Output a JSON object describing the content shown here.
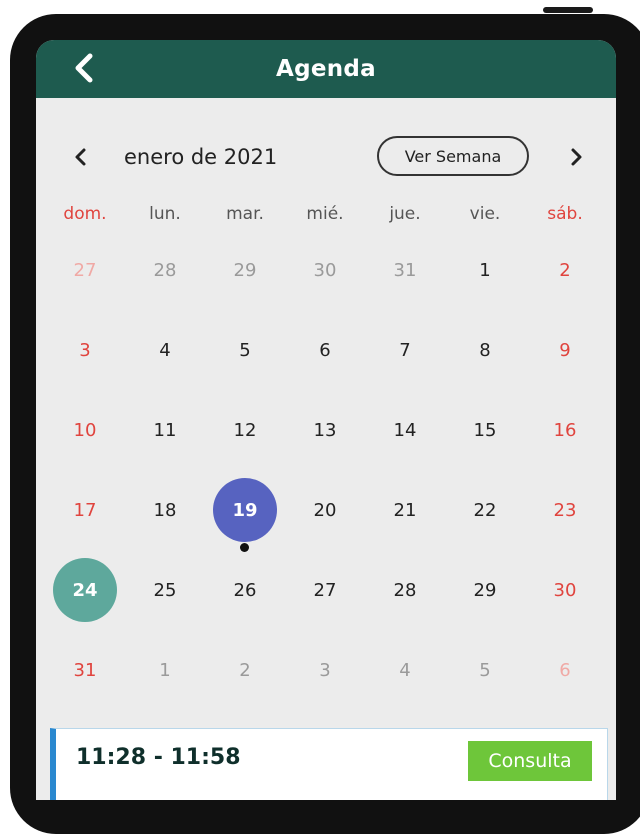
{
  "header": {
    "title": "Agenda",
    "back_icon": "chevron-left-icon",
    "bg_color": "#1e5b4f"
  },
  "calendar": {
    "month_label": "enero de 2021",
    "week_button_label": "Ver Semana",
    "prev_icon": "chevron-left-icon",
    "next_icon": "chevron-right-icon",
    "weekdays": [
      "dom.",
      "lun.",
      "mar.",
      "mié.",
      "jue.",
      "vie.",
      "sáb."
    ],
    "selected_day": "19",
    "today": "24",
    "colors": {
      "weekend": "#e0443e",
      "selected": "#5763c0",
      "today": "#5ea89c"
    },
    "weeks": [
      [
        {
          "d": "27",
          "o": true
        },
        {
          "d": "28",
          "o": true
        },
        {
          "d": "29",
          "o": true
        },
        {
          "d": "30",
          "o": true
        },
        {
          "d": "31",
          "o": true
        },
        {
          "d": "1"
        },
        {
          "d": "2"
        }
      ],
      [
        {
          "d": "3"
        },
        {
          "d": "4"
        },
        {
          "d": "5"
        },
        {
          "d": "6"
        },
        {
          "d": "7"
        },
        {
          "d": "8"
        },
        {
          "d": "9"
        }
      ],
      [
        {
          "d": "10"
        },
        {
          "d": "11"
        },
        {
          "d": "12"
        },
        {
          "d": "13"
        },
        {
          "d": "14"
        },
        {
          "d": "15"
        },
        {
          "d": "16"
        }
      ],
      [
        {
          "d": "17"
        },
        {
          "d": "18"
        },
        {
          "d": "19",
          "sel": true,
          "dot": true
        },
        {
          "d": "20"
        },
        {
          "d": "21"
        },
        {
          "d": "22"
        },
        {
          "d": "23"
        }
      ],
      [
        {
          "d": "24",
          "today": true
        },
        {
          "d": "25"
        },
        {
          "d": "26"
        },
        {
          "d": "27"
        },
        {
          "d": "28"
        },
        {
          "d": "29"
        },
        {
          "d": "30"
        }
      ],
      [
        {
          "d": "31"
        },
        {
          "d": "1",
          "o": true
        },
        {
          "d": "2",
          "o": true
        },
        {
          "d": "3",
          "o": true
        },
        {
          "d": "4",
          "o": true
        },
        {
          "d": "5",
          "o": true
        },
        {
          "d": "6",
          "o": true
        }
      ]
    ]
  },
  "appointment": {
    "time": "11:28 - 11:58",
    "tag": "Consulta",
    "tag_color": "#6ec63a",
    "accent_color": "#2a88cf"
  }
}
